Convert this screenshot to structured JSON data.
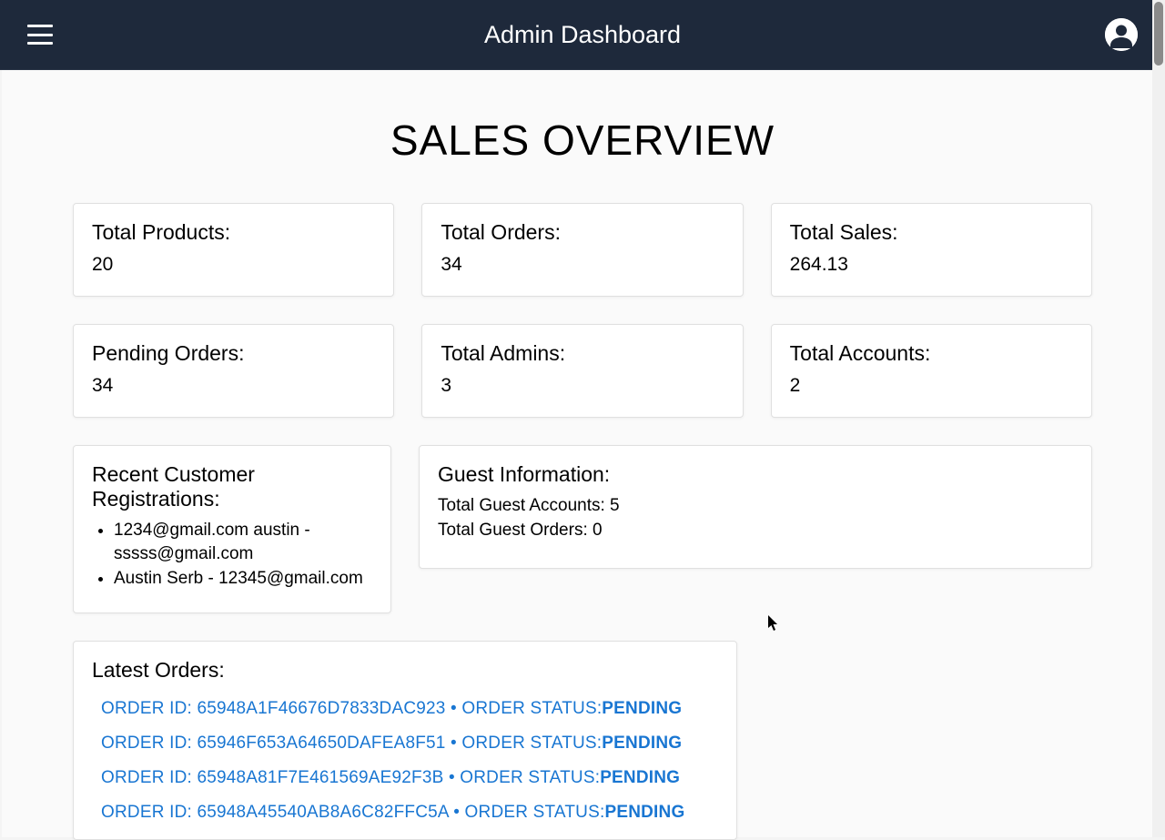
{
  "header": {
    "title": "Admin Dashboard"
  },
  "page": {
    "title": "SALES OVERVIEW"
  },
  "stats": {
    "total_products": {
      "label": "Total Products:",
      "value": "20"
    },
    "total_orders": {
      "label": "Total Orders:",
      "value": "34"
    },
    "total_sales": {
      "label": "Total Sales:",
      "value": "264.13"
    },
    "pending_orders": {
      "label": "Pending Orders:",
      "value": "34"
    },
    "total_admins": {
      "label": "Total Admins:",
      "value": "3"
    },
    "total_accounts": {
      "label": "Total Accounts:",
      "value": "2"
    }
  },
  "registrations": {
    "title": "Recent Customer Registrations:",
    "items": [
      "1234@gmail.com austin - sssss@gmail.com",
      "Austin Serb - 12345@gmail.com"
    ]
  },
  "guest": {
    "title": "Guest Information:",
    "accounts_label": "Total Guest Accounts: ",
    "accounts_value": "5",
    "orders_label": "Total Guest Orders: ",
    "orders_value": "0"
  },
  "latest_orders": {
    "title": "Latest Orders:",
    "order_id_label": "ORDER ID: ",
    "status_label": " • ORDER STATUS:",
    "items": [
      {
        "id": "65948A1F46676D7833DAC923",
        "status": "PENDING"
      },
      {
        "id": "65946F653A64650DAFEA8F51",
        "status": "PENDING"
      },
      {
        "id": "65948A81F7E461569AE92F3B",
        "status": "PENDING"
      },
      {
        "id": "65948A45540AB8A6C82FFC5A",
        "status": "PENDING"
      }
    ]
  }
}
